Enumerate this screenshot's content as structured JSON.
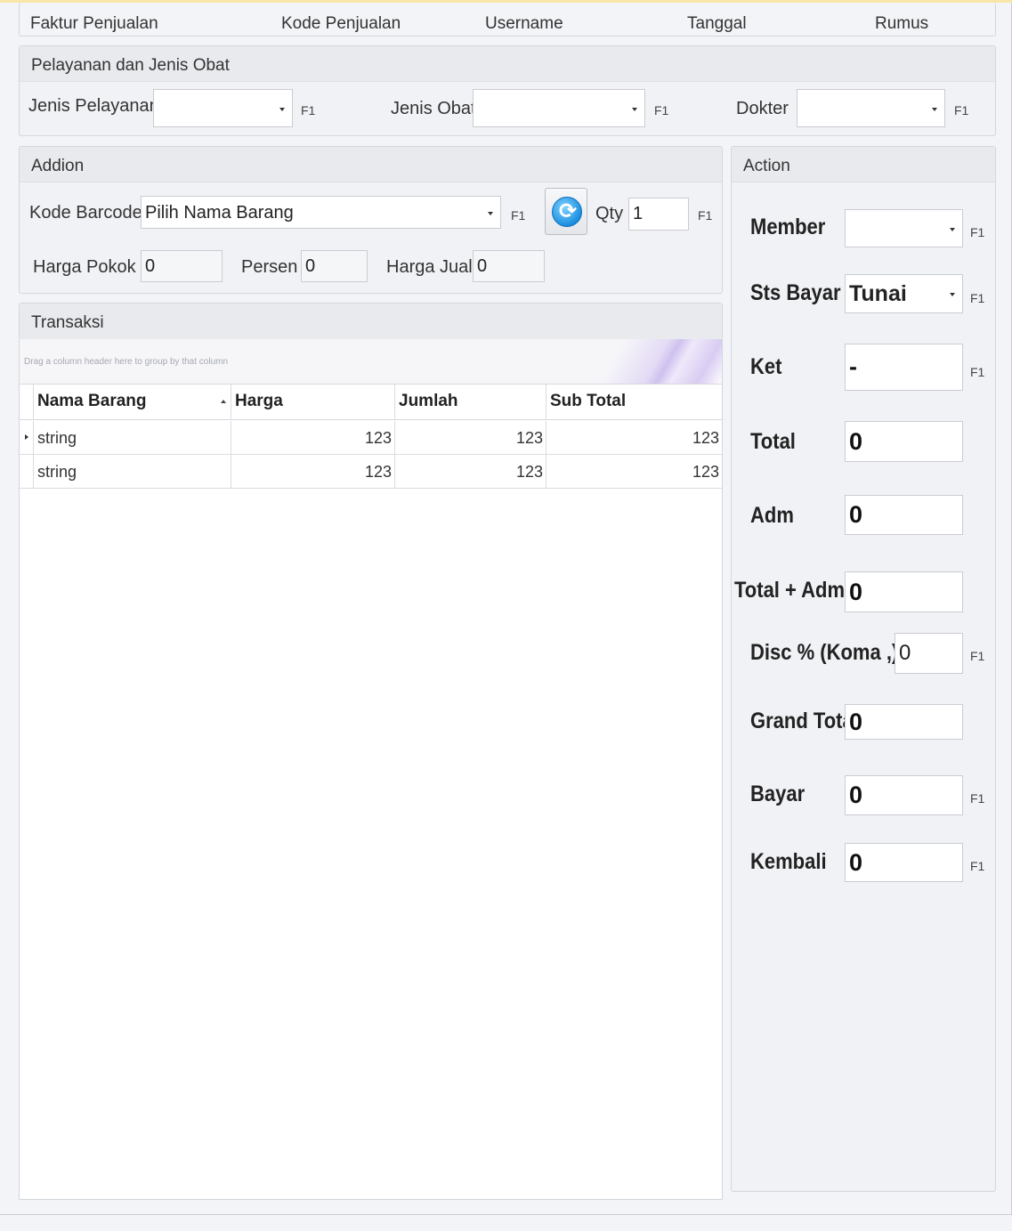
{
  "header": {
    "faktur_label": "Faktur Penjualan",
    "kode_label": "Kode Penjualan",
    "username_label": "Username",
    "tanggal_label": "Tanggal",
    "rumus_label": "Rumus"
  },
  "pelayanan": {
    "title": "Pelayanan dan Jenis Obat",
    "jenis_pelayanan_label": "Jenis Pelayanan",
    "jenis_pelayanan_value": "",
    "jenis_obat_label": "Jenis Obat",
    "jenis_obat_value": "",
    "dokter_label": "Dokter",
    "dokter_value": "",
    "hotkey": "F1"
  },
  "addion": {
    "title": "Addion",
    "kode_barcode_label": "Kode Barcode",
    "barang_value": "Pilih Nama Barang",
    "qty_label": "Qty",
    "qty_value": "1",
    "harga_pokok_label": "Harga Pokok",
    "harga_pokok_value": "0",
    "persen_label": "Persen",
    "persen_value": "0",
    "harga_jual_label": "Harga Jual",
    "harga_jual_value": "0",
    "hotkey": "F1",
    "refresh_icon": "refresh-icon"
  },
  "transaksi": {
    "title": "Transaksi",
    "group_hint": "Drag a column header here to group by that column",
    "columns": [
      "Nama Barang",
      "Harga",
      "Jumlah",
      "Sub Total"
    ],
    "rows": [
      [
        "string",
        "123",
        "123",
        "123"
      ],
      [
        "string",
        "123",
        "123",
        "123"
      ]
    ]
  },
  "action": {
    "title": "Action",
    "hotkey": "F1",
    "member_label": "Member",
    "member_value": "",
    "sts_bayar_label": "Sts Bayar",
    "sts_bayar_value": "Tunai",
    "ket_label": "Ket",
    "ket_value": "-",
    "total_label": "Total",
    "total_value": "0",
    "adm_label": "Adm",
    "adm_value": "0",
    "total_adm_label": "Total + Adm",
    "total_adm_value": "0",
    "disc_label": "Disc % (Koma ,)",
    "disc_value": "0",
    "grand_total_label": "Grand Total",
    "grand_total_value": "0",
    "bayar_label": "Bayar",
    "bayar_value": "0",
    "kembali_label": "Kembali",
    "kembali_value": "0"
  }
}
